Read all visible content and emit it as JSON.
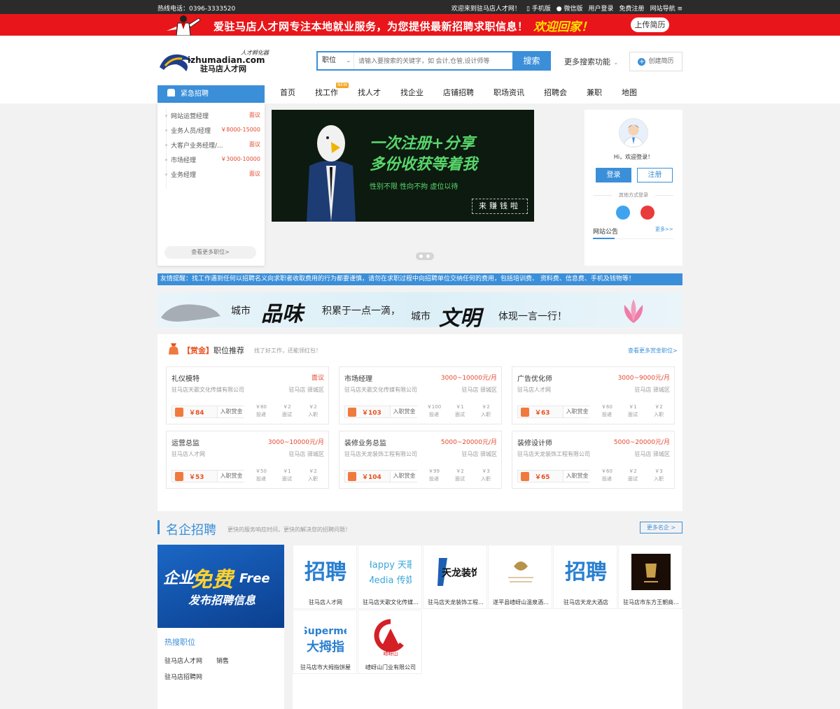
{
  "topbar": {
    "phone": "热线电话：0396-3333520",
    "welcome": "欢迎来到驻马店人才网！",
    "mobile": "手机版",
    "wechat": "微信版",
    "login": "用户登录",
    "register": "免费注册",
    "sitenav": "网站导航"
  },
  "redbanner": {
    "slogan": "爱驻马店人才网专注本地就业服务，为您提供最新招聘求职信息！",
    "welcome": "欢迎回家！",
    "upload": "上传简历"
  },
  "logo": {
    "domain": "izhumadian.com",
    "name": "驻马店人才网",
    "tagline": "人才孵化器"
  },
  "search": {
    "category": "职位",
    "placeholder": "请输入要搜索的关键字，如 会计,仓管,设计师等",
    "button": "搜索",
    "more": "更多搜索功能",
    "resume": "创建简历"
  },
  "nav": {
    "urgent": "紧急招聘",
    "items": [
      "首页",
      "找工作",
      "找人才",
      "找企业",
      "店铺招聘",
      "职场资讯",
      "招聘会",
      "兼职",
      "地图"
    ],
    "new_badge": "NEW"
  },
  "urgent_jobs": [
    {
      "title": "网站运营经理",
      "salary": "面议"
    },
    {
      "title": "业务人员/经理",
      "salary": "￥8000-15000"
    },
    {
      "title": "大客户业务经理/...",
      "salary": "面议"
    },
    {
      "title": "市场经理",
      "salary": "￥3000-10000"
    },
    {
      "title": "业务经理",
      "salary": "面议"
    }
  ],
  "urgent_more": "查看更多职位>",
  "hero": {
    "line1": "一次注册+分享",
    "line2": "多份收获等着我",
    "line3": "性别不限  性向不拘  虚位以待",
    "box": "来赚钱啦"
  },
  "userpanel": {
    "hi": "Hi，欢迎登录！",
    "login": "登录",
    "register": "注册",
    "other": "其他方式登录",
    "notice": "网站公告",
    "notice_more": "更多>>"
  },
  "tip": "友情提醒：找工作遇到任何以招聘名义向求职者收取费用的行为都要谨慎，请勿在求职过程中向招聘单位交纳任何的费用，包括培训费、 资料费、信息费、手机及钱物等！",
  "ink": {
    "p1": "城市",
    "p2": "品味",
    "p3": "积累于一点一滴，",
    "p4": "城市",
    "p5": "文明",
    "p6": "体现一言一行！"
  },
  "reward": {
    "gold": "【赏金】",
    "title": "职位推荐",
    "sub": "找了好工作，还能领红包！",
    "more": "查看更多赏金职位>",
    "bonus_label": "入职赏金",
    "stat_labels": [
      "投递",
      "面试",
      "入职"
    ],
    "cards": [
      {
        "title": "礼仪模特",
        "salary": "面议",
        "company": "驻马店天歌文化传媒有限公司",
        "location": "驻马店 驿城区",
        "bonus": "￥84",
        "stats": [
          "￥80",
          "￥2",
          "￥2"
        ]
      },
      {
        "title": "市场经理",
        "salary": "3000~10000元/月",
        "company": "驻马店天歌文化传媒有限公司",
        "location": "驻马店 驿城区",
        "bonus": "￥103",
        "stats": [
          "￥100",
          "￥1",
          "￥2"
        ]
      },
      {
        "title": "广告优化师",
        "salary": "3000~9000元/月",
        "company": "驻马店人才网",
        "location": "驻马店 驿城区",
        "bonus": "￥63",
        "stats": [
          "￥60",
          "￥1",
          "￥2"
        ]
      },
      {
        "title": "运营总监",
        "salary": "3000~10000元/月",
        "company": "驻马店人才网",
        "location": "驻马店 驿城区",
        "bonus": "￥53",
        "stats": [
          "￥50",
          "￥1",
          "￥2"
        ]
      },
      {
        "title": "装修业务总监",
        "salary": "5000~20000元/月",
        "company": "驻马店天龙装饰工程有限公司",
        "location": "驻马店 驿城区",
        "bonus": "￥104",
        "stats": [
          "￥99",
          "￥2",
          "￥3"
        ]
      },
      {
        "title": "装修设计师",
        "salary": "5000~20000元/月",
        "company": "驻马店天龙装饰工程有限公司",
        "location": "驻马店 驿城区",
        "bonus": "￥65",
        "stats": [
          "￥60",
          "￥2",
          "￥3"
        ]
      }
    ]
  },
  "famous": {
    "title": "名企招聘",
    "sub": "更快的服务响应时间，更快的解决您的招聘问题！",
    "more": "更多名企 >",
    "ad": {
      "f1": "企业",
      "f2": "免费",
      "f3": "Free",
      "f4": "发布招聘信息"
    },
    "hot_title": "热搜职位",
    "hot": [
      "驻马店人才网",
      "销售",
      "驻马店招聘网"
    ],
    "companies": [
      {
        "name": "驻马店人才网",
        "logo": "招聘"
      },
      {
        "name": "驻马店天歌文化传媒...",
        "logo": "Happy 天歌 Media 传媒"
      },
      {
        "name": "驻马店天龙装饰工程...",
        "logo": "天龙装饰"
      },
      {
        "name": "遂平县嵖岈山温泉酒...",
        "logo": ""
      },
      {
        "name": "驻马店天龙大酒店",
        "logo": "招聘"
      },
      {
        "name": "驻马店市东方王朝商...",
        "logo": ""
      },
      {
        "name": "驻马店市大拇指饼屋",
        "logo": "Superme 大拇指"
      },
      {
        "name": "嵖岈山门业有限公司",
        "logo": "嵖岈山"
      }
    ]
  },
  "colors": {
    "primary": "#3b8fd9",
    "red": "#e8161a",
    "accent": "#e8501f"
  }
}
